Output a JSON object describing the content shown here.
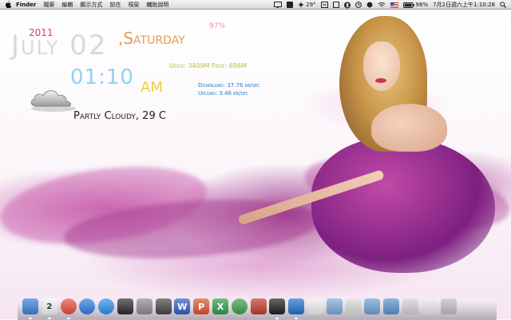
{
  "menubar": {
    "items": [
      "Finder",
      "檔案",
      "編輯",
      "顯示方式",
      "前往",
      "視窗",
      "輔助說明"
    ],
    "status": {
      "temperature": "29°",
      "battery": "98%",
      "clock": "7月2日週六上午1:10:28"
    }
  },
  "widgets": {
    "year": "2011",
    "date": "July 02",
    "day": ",Saturday",
    "battery": "97%",
    "memory": "Used: 3409M Free: 686M",
    "time": "01:10",
    "ampm": "AM",
    "download": "Download: 37.76 kb/sec",
    "upload": "Upload: 3.46 kb/sec",
    "weather": "Partly Cloudy, 29 C"
  },
  "dock": {
    "apps": [
      {
        "icon": "finder-icon",
        "color": "#3b7fd6",
        "running": true
      },
      {
        "icon": "calendar-icon",
        "color": "#f2f2f2",
        "running": true
      },
      {
        "icon": "chrome-icon",
        "color": "#e94b3c",
        "running": true
      },
      {
        "icon": "itunes-icon",
        "color": "#2f7be0",
        "running": false
      },
      {
        "icon": "app-store-icon",
        "color": "#2c8fe8",
        "running": false
      },
      {
        "icon": "camera-icon",
        "color": "#2a2a2a",
        "running": false
      },
      {
        "icon": "preview-icon",
        "color": "#8b8b8b",
        "running": false
      },
      {
        "icon": "calculator-icon",
        "color": "#444444",
        "running": false
      },
      {
        "icon": "word-icon",
        "color": "#2b5fbd",
        "running": false
      },
      {
        "icon": "powerpoint-icon",
        "color": "#d9532b",
        "running": false
      },
      {
        "icon": "excel-icon",
        "color": "#2e9a44",
        "running": false
      },
      {
        "icon": "messenger-icon",
        "color": "#3aa04a",
        "running": false
      },
      {
        "icon": "remote-desktop-icon",
        "color": "#c0392b",
        "running": false
      },
      {
        "icon": "dvd-player-icon",
        "color": "#1d1d1d",
        "running": true
      },
      {
        "icon": "teamviewer-icon",
        "color": "#1e6fc9",
        "running": true
      },
      {
        "icon": "textedit-icon",
        "color": "#eeeeee",
        "running": false
      },
      {
        "icon": "applications-folder-icon",
        "color": "#7aa7d8",
        "running": false
      },
      {
        "icon": "documents-icon",
        "color": "#d9d9d9",
        "running": false
      },
      {
        "icon": "folder-icon",
        "color": "#6f9fd3",
        "running": false
      },
      {
        "icon": "downloads-icon",
        "color": "#5b8fca",
        "running": false
      },
      {
        "icon": "stack-icon",
        "color": "#cfcfcf",
        "running": false
      },
      {
        "icon": "stack-icon",
        "color": "#e6e6e6",
        "running": false
      },
      {
        "icon": "trash-icon",
        "color": "#bdbdbd",
        "running": false
      }
    ],
    "labels": {
      "calendar": "2",
      "word": "W",
      "powerpoint": "P",
      "excel": "X"
    }
  },
  "colors": {
    "year": "#e0357f",
    "day": "#e89a55",
    "time": "#8fd3f0",
    "ampm": "#f0cf3f",
    "memory": "#b7c23c",
    "network": "#1f7ec8"
  }
}
